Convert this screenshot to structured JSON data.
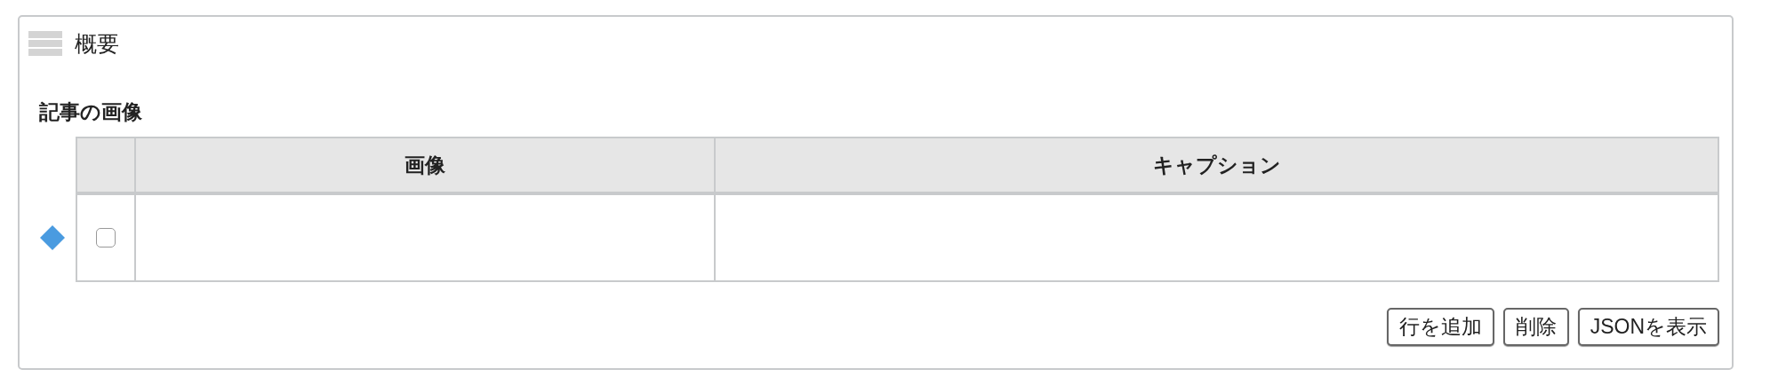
{
  "panel": {
    "title": "概要"
  },
  "section": {
    "title": "記事の画像",
    "table": {
      "columns": [
        "画像",
        "キャプション"
      ],
      "rows": [
        {
          "checked": false
        }
      ]
    }
  },
  "buttons": [
    "行を追加",
    "削除",
    "JSONを表示"
  ]
}
